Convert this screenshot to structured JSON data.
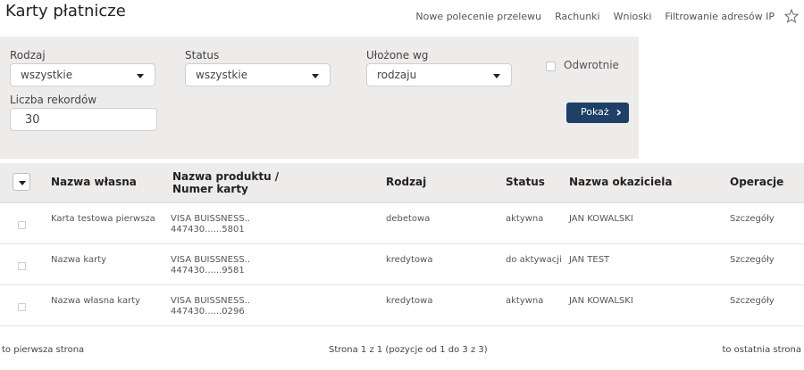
{
  "page": {
    "title": "Karty płatnicze"
  },
  "topnav": {
    "items": [
      "Nowe polecenie przelewu",
      "Rachunki",
      "Wnioski",
      "Filtrowanie adresów IP"
    ]
  },
  "filters": {
    "rodzaj": {
      "label": "Rodzaj",
      "value": "wszystkie"
    },
    "status": {
      "label": "Status",
      "value": "wszystkie"
    },
    "sort": {
      "label": "Ułożone wg",
      "value": "rodzaju"
    },
    "reverse": {
      "label": "Odwrotnie",
      "checked": false
    },
    "records": {
      "label": "Liczba rekordów",
      "value": "30"
    },
    "show_button": "Pokaż"
  },
  "table": {
    "headers": {
      "name": "Nazwa własna",
      "product_line1": "Nazwa produktu /",
      "product_line2": "Numer karty",
      "type": "Rodzaj",
      "status": "Status",
      "holder": "Nazwa okaziciela",
      "ops": "Operacje"
    },
    "rows": [
      {
        "name": "Karta testowa pierwsza",
        "product": "VISA BUISSNESS..",
        "number": "447430......5801",
        "type": "debetowa",
        "status": "aktywna",
        "holder": "JAN KOWALSKI",
        "op": "Szczegóły"
      },
      {
        "name": "Nazwa karty",
        "product": "VISA BUISSNESS..",
        "number": "447430......9581",
        "type": "kredytowa",
        "status": "do aktywacji",
        "holder": "JAN TEST",
        "op": "Szczegóły"
      },
      {
        "name": "Nazwa własna karty",
        "product": "VISA BUISSNESS..",
        "number": "447430......0296",
        "type": "kredytowa",
        "status": "aktywna",
        "holder": "JAN KOWALSKI",
        "op": "Szczegóły"
      }
    ]
  },
  "footer": {
    "first": "to pierwsza strona",
    "info": "Strona 1 z 1 (pozycje od 1 do 3 z 3)",
    "last": "to ostatnia strona"
  }
}
